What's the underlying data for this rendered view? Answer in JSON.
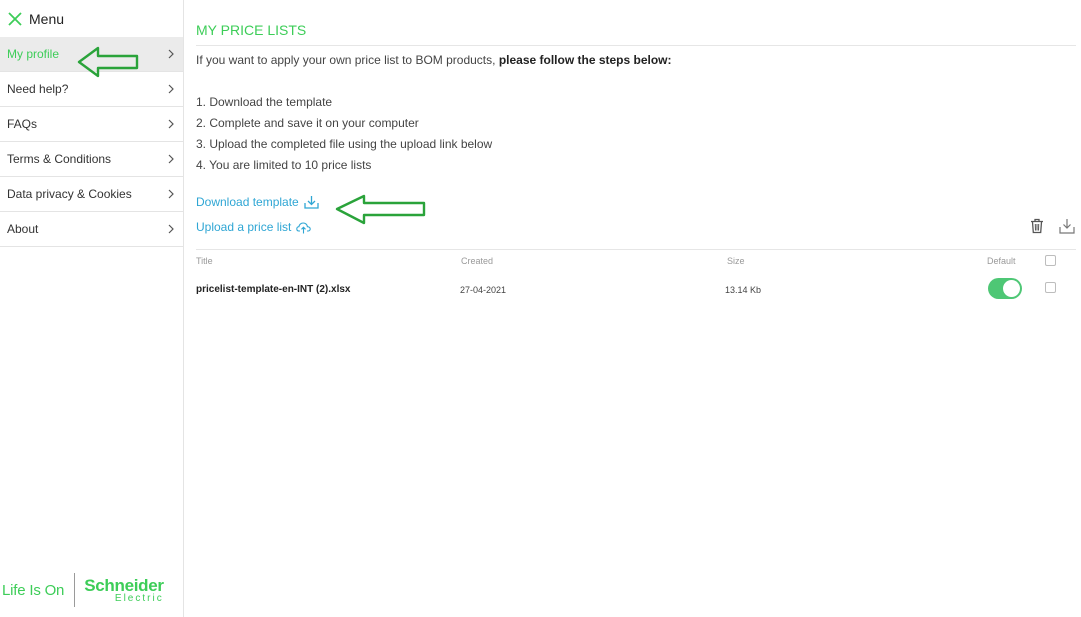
{
  "sidebar": {
    "menu_label": "Menu",
    "items": [
      {
        "label": "My profile"
      },
      {
        "label": "Need help?"
      },
      {
        "label": "FAQs"
      },
      {
        "label": "Terms & Conditions"
      },
      {
        "label": "Data privacy & Cookies"
      },
      {
        "label": "About"
      }
    ],
    "brand": {
      "tagline": "Life Is On",
      "name": "Schneider",
      "sub": "Electric"
    }
  },
  "main": {
    "title": "MY PRICE LISTS",
    "intro_text": "If you want to apply your own price list to BOM products, ",
    "intro_bold": "please follow the steps below:",
    "steps": [
      "1. Download the template",
      "2. Complete and save it on your computer",
      "3. Upload the completed file using the upload link below",
      "4. You are limited to 10 price lists"
    ],
    "download_link": "Download template",
    "upload_link": "Upload a price list",
    "table": {
      "headers": {
        "title": "Title",
        "created": "Created",
        "size": "Size",
        "default": "Default"
      },
      "rows": [
        {
          "title": "pricelist-template-en-INT (2).xlsx",
          "created": "27-04-2021",
          "size": "13.14 Kb",
          "default": true
        }
      ]
    }
  },
  "colors": {
    "accent": "#3dcd58",
    "link": "#2fa6d4",
    "annotation_arrow": "#2aa33a"
  }
}
